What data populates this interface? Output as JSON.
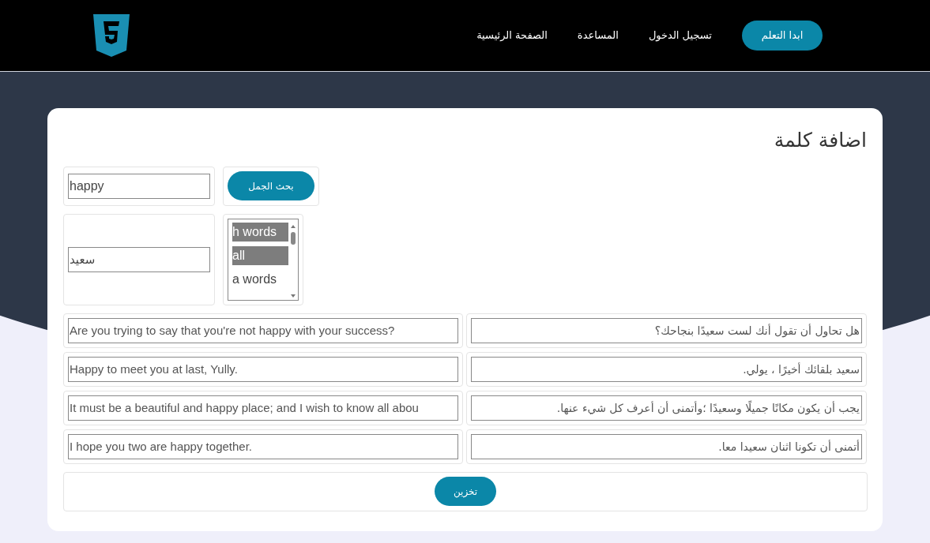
{
  "nav": {
    "cta": "ابدا التعلم",
    "links": [
      "تسجيل الدخول",
      "المساعدة",
      "الصفحة الرئيسية"
    ]
  },
  "card": {
    "title": "اضافة كلمة",
    "search": {
      "value": "happy",
      "button": "بحث الجمل"
    },
    "word": {
      "value": "سعيد"
    },
    "listbox": [
      {
        "label": "h words",
        "selected": true
      },
      {
        "label": "all",
        "selected": true
      },
      {
        "label": "a words",
        "selected": false
      }
    ],
    "sentences": [
      {
        "english": "Are you trying to say that you're not happy with your success?",
        "arabic": "هل تحاول أن تقول أنك لست سعيدًا بنجاحك؟"
      },
      {
        "english": "Happy to meet you at last, Yully.",
        "arabic": "سعيد بلقائك أخيرًا ، يولي."
      },
      {
        "english": "It must be a beautiful and happy place; and I wish to know all abou",
        "arabic": "يجب أن يكون مكانًا جميلًا وسعيدًا ؛وأتمنى أن أعرف كل شيء عنها."
      },
      {
        "english": "I hope you two are happy together.",
        "arabic": "أتمنى أن تكونا اثنان سعيدا معا."
      }
    ],
    "save": "تخزين"
  }
}
